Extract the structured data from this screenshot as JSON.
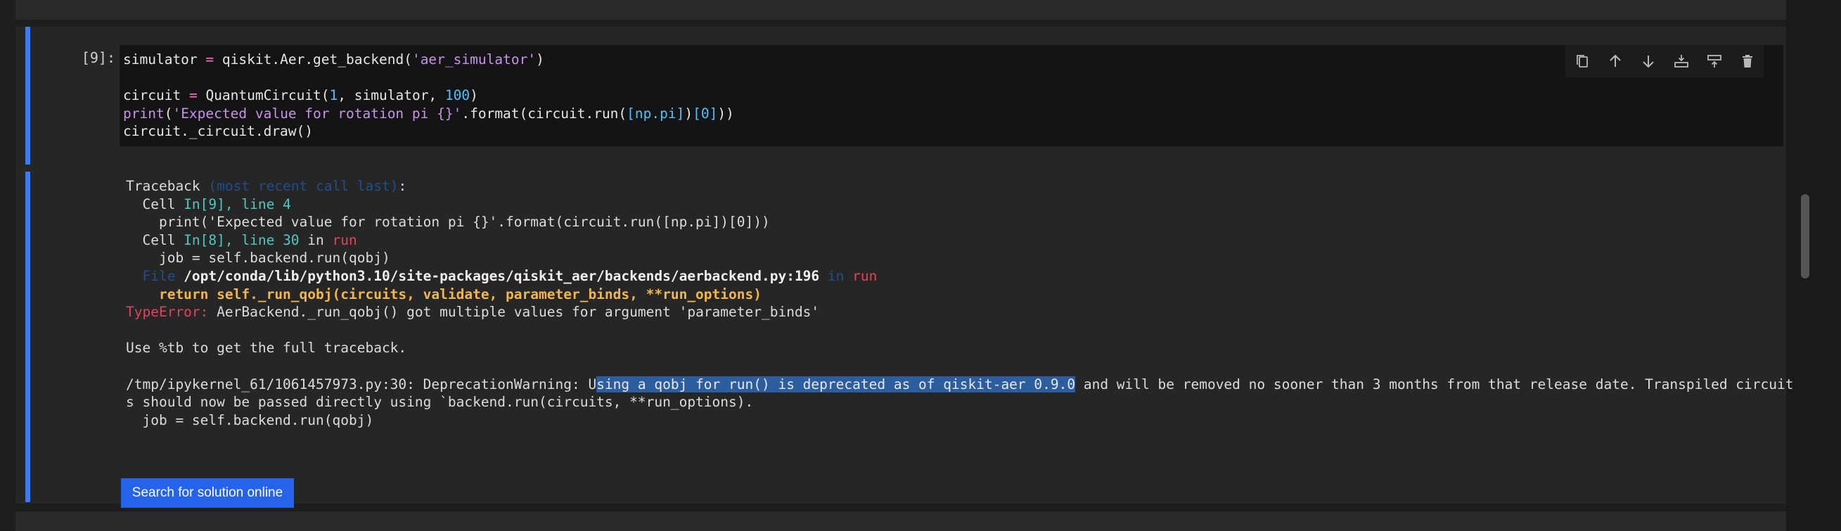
{
  "cell": {
    "prompt": "[9]:",
    "code": {
      "line1": {
        "var": "simulator",
        "op": "=",
        "call": "qiskit.Aer.get_backend(",
        "arg": "'aer_simulator'",
        "close": ")"
      },
      "line3": {
        "var": "circuit",
        "op": "=",
        "call": "QuantumCircuit(",
        "n1": "1",
        "mid": ", simulator, ",
        "n2": "100",
        "close": ")"
      },
      "line4": {
        "fn": "print",
        "open": "(",
        "str": "'Expected value for rotation pi {}'",
        "mid": ".format(circuit.run(",
        "br": "[np.pi]",
        "mid2": ")",
        "idx": "[0]",
        "close": "))"
      },
      "line5": "circuit._circuit.draw()"
    },
    "toolbar": {
      "duplicate": "duplicate-icon",
      "move_up": "arrow-up-icon",
      "move_down": "arrow-down-icon",
      "insert_above": "insert-above-icon",
      "insert_below": "insert-below-icon",
      "delete": "trash-icon"
    }
  },
  "output": {
    "tb_head": "Traceback ",
    "tb_recent": "(most recent call last)",
    "tb_colon": ":",
    "frame1_cell": "  Cell ",
    "frame1_loc": "In[9], line 4",
    "frame1_code": "    print('Expected value for rotation pi {}'.format(circuit.run([np.pi])[0]))",
    "frame2_cell": "  Cell ",
    "frame2_loc": "In[8], line 30",
    "frame2_in": " in ",
    "frame2_fn": "run",
    "frame2_code": "    job = self.backend.run(qobj)",
    "frame3_file": "  File ",
    "frame3_path": "/opt/conda/lib/python3.10/site-packages/qiskit_aer/backends/aerbackend.py:196",
    "frame3_in": " in ",
    "frame3_fn": "run",
    "frame3_code": "    return self._run_qobj(circuits, validate, parameter_binds, **run_options)",
    "err_type": "TypeError:",
    "err_msg": " AerBackend._run_qobj() got multiple values for argument 'parameter_binds'",
    "hint": "Use %tb to get the full traceback.",
    "warn_prefix": "/tmp/ipykernel_61/1061457973.py:30: DeprecationWarning: U",
    "warn_selected": "sing a qobj for run() is deprecated as of qiskit-aer 0.9.0",
    "warn_rest": " and will be removed no sooner than 3 months from that release date. Transpiled circuit",
    "warn_line2": "s should now be passed directly using `backend.run(circuits, **run_options).",
    "warn_line3": "  job = self.backend.run(qobj)",
    "search_button": "Search for solution online"
  }
}
